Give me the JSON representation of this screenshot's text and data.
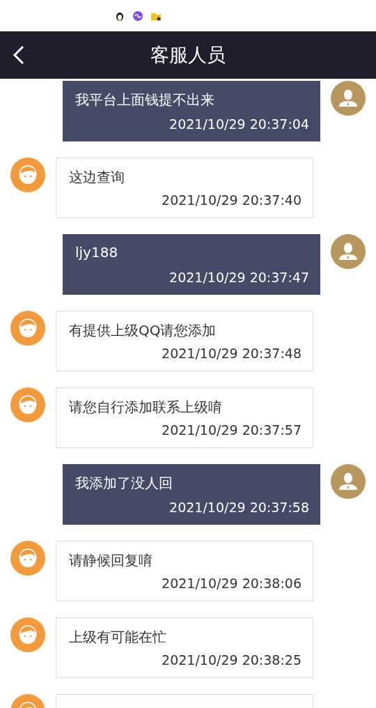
{
  "header": {
    "title": "客服人员"
  },
  "messages": [
    {
      "kind": "sent",
      "text": "我平台上面钱提不出来",
      "time": "2021/10/29 20:37:04"
    },
    {
      "kind": "received",
      "text": "这边查询",
      "time": "2021/10/29 20:37:40"
    },
    {
      "kind": "sent",
      "text": "ljy188",
      "time": "2021/10/29 20:37:47"
    },
    {
      "kind": "received",
      "text": "有提供上级QQ请您添加",
      "time": "2021/10/29 20:37:48"
    },
    {
      "kind": "received",
      "text": "请您自行添加联系上级唷",
      "time": "2021/10/29 20:37:57"
    },
    {
      "kind": "sent",
      "text": "我添加了没人回",
      "time": "2021/10/29 20:37:58"
    },
    {
      "kind": "received",
      "text": "请静候回复唷",
      "time": "2021/10/29 20:38:06"
    },
    {
      "kind": "received",
      "text": "上级有可能在忙",
      "time": "2021/10/29 20:38:25"
    },
    {
      "kind": "received"
    }
  ]
}
